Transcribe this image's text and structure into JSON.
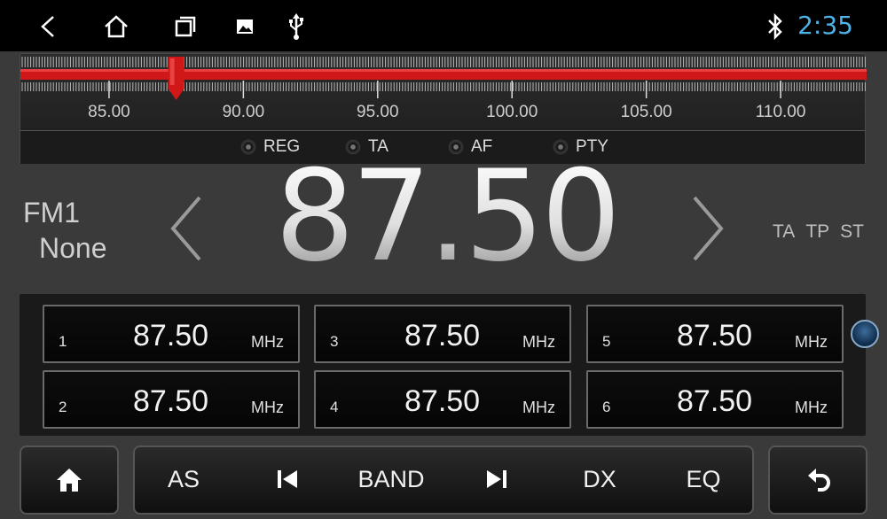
{
  "statusbar": {
    "icons": [
      "back-icon",
      "home-icon",
      "recents-icon",
      "gallery-icon",
      "usb-icon",
      "bluetooth-icon"
    ],
    "time": "2:35",
    "time_color": "#4fb3e8"
  },
  "tuner": {
    "scale_labels": [
      "85.00",
      "90.00",
      "95.00",
      "100.00",
      "105.00",
      "110.00"
    ],
    "scale_min": 81.7,
    "scale_max": 113.2,
    "needle_value": 87.5,
    "accent_color": "#d01818",
    "flags": [
      {
        "label": "REG"
      },
      {
        "label": "TA"
      },
      {
        "label": "AF"
      },
      {
        "label": "PTY"
      }
    ]
  },
  "station": {
    "band": "FM1",
    "ps_name": "None",
    "frequency": "87.50",
    "indicators": [
      "TA",
      "TP",
      "ST"
    ]
  },
  "presets": [
    {
      "num": "1",
      "freq": "87.50",
      "unit": "MHz"
    },
    {
      "num": "2",
      "freq": "87.50",
      "unit": "MHz"
    },
    {
      "num": "3",
      "freq": "87.50",
      "unit": "MHz"
    },
    {
      "num": "4",
      "freq": "87.50",
      "unit": "MHz"
    },
    {
      "num": "5",
      "freq": "87.50",
      "unit": "MHz"
    },
    {
      "num": "6",
      "freq": "87.50",
      "unit": "MHz"
    }
  ],
  "controls": {
    "as": "AS",
    "band": "BAND",
    "dx": "DX",
    "eq": "EQ",
    "icons": [
      "home-icon",
      "prev-icon",
      "next-icon",
      "return-icon"
    ]
  }
}
